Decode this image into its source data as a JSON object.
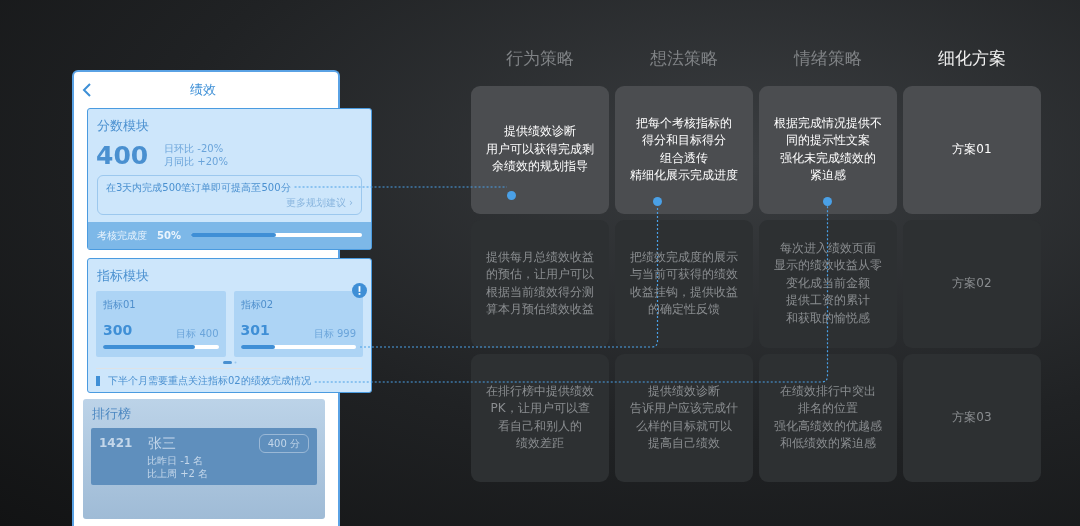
{
  "phone": {
    "title": "绩效",
    "score_module": {
      "title": "分数模块",
      "score": "400",
      "compare": [
        {
          "label": "日环比",
          "value": "-20%"
        },
        {
          "label": "月同比",
          "value": "+20%"
        }
      ],
      "tip": "在3天内完成500笔订单即可提高至500分",
      "tip_link": "更多规划建议 ›",
      "progress_label": "考核完成度",
      "progress_value": "50%",
      "level": 0.5
    },
    "index_module": {
      "title": "指标模块",
      "cards": [
        {
          "name": "指标01",
          "value": "300",
          "target_label": "目标",
          "target": "400",
          "level": 0.8,
          "alert": false
        },
        {
          "name": "指标02",
          "value": "301",
          "target_label": "目标",
          "target": "999",
          "level": 0.3,
          "alert": true
        }
      ],
      "note": "下半个月需要重点关注指标02的绩效完成情况"
    },
    "ranking": {
      "title": "排行榜",
      "rank": "1421",
      "name": "张三",
      "changes": [
        "比昨日 -1 名",
        "比上周 +2 名"
      ],
      "score": "400 分"
    }
  },
  "strategy": {
    "columns": [
      {
        "title": "行为策略",
        "selected": false
      },
      {
        "title": "想法策略",
        "selected": false
      },
      {
        "title": "情绪策略",
        "selected": false
      },
      {
        "title": "细化方案",
        "selected": true
      }
    ],
    "rows": [
      {
        "active": true,
        "cells": [
          {
            "lines": [
              "提供绩效诊断",
              "用户可以获得完成剩",
              "余绩效的规划指导"
            ],
            "connector": true
          },
          {
            "lines": [
              "把每个考核指标的",
              "得分和目标得分",
              "组合透传",
              "精细化展示完成进度"
            ],
            "connector": true
          },
          {
            "lines": [
              "根据完成情况提供不",
              "同的提示性文案",
              "强化未完成绩效的",
              "紧迫感"
            ],
            "connector": true
          },
          {
            "lines": [
              "方案01"
            ],
            "connector": false
          }
        ]
      },
      {
        "active": false,
        "cells": [
          {
            "lines": [
              "提供每月总绩效收益",
              "的预估，让用户可以",
              "根据当前绩效得分测",
              "算本月预估绩效收益"
            ],
            "connector": false
          },
          {
            "lines": [
              "把绩效完成度的展示",
              "与当前可获得的绩效",
              "收益挂钩，提供收益",
              "的确定性反馈"
            ],
            "connector": false
          },
          {
            "lines": [
              "每次进入绩效页面",
              "显示的绩效收益从零",
              "变化成当前金额",
              "提供工资的累计",
              "和获取的愉悦感"
            ],
            "connector": false
          },
          {
            "lines": [
              "方案02"
            ],
            "connector": false
          }
        ]
      },
      {
        "active": false,
        "cells": [
          {
            "lines": [
              "在排行榜中提供绩效",
              "PK，让用户可以查",
              "看自己和别人的",
              "绩效差距"
            ],
            "connector": false
          },
          {
            "lines": [
              "提供绩效诊断",
              "告诉用户应该完成什",
              "么样的目标就可以",
              "提高自己绩效"
            ],
            "connector": false
          },
          {
            "lines": [
              "在绩效排行中突出",
              "排名的位置",
              "强化高绩效的优越感",
              "和低绩效的紧迫感"
            ],
            "connector": false
          },
          {
            "lines": [
              "方案03"
            ],
            "connector": false
          }
        ]
      }
    ]
  }
}
